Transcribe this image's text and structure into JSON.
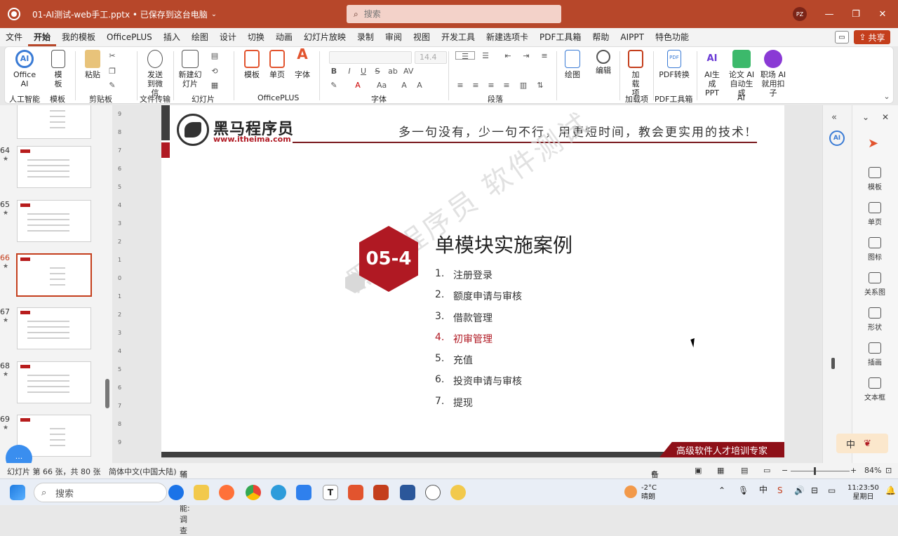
{
  "titlebar": {
    "doc_title": "01-AI测试-web手工.pptx • 已保存到这台电脑",
    "search_placeholder": "搜索",
    "avatar": "PZ",
    "minimize": "—",
    "restore": "❐",
    "close": "✕"
  },
  "menu": {
    "items": [
      "文件",
      "开始",
      "我的模板",
      "OfficePLUS",
      "插入",
      "绘图",
      "设计",
      "切换",
      "动画",
      "幻灯片放映",
      "录制",
      "审阅",
      "视图",
      "开发工具",
      "新建选项卡",
      "PDF工具箱",
      "帮助",
      "AIPPT",
      "特色功能"
    ],
    "active": "开始",
    "share": "共享"
  },
  "ribbon": {
    "buttons": {
      "office_ai": "Office AI",
      "template": "模板",
      "paste": "粘贴",
      "send_wechat": "发送到微信",
      "new_slide": "新建幻灯片",
      "opl_template": "模板",
      "opl_single": "单页",
      "opl_font": "字体",
      "draw": "绘图",
      "edit": "编辑",
      "addin": "加载项",
      "pdf_convert": "PDF转换",
      "ai_ppt": "AI生成PPT",
      "paper_ai": "论文 AI 自动生成",
      "job_ai": "职场 AI 就用扣子"
    },
    "groups": {
      "ai_assist": "人工智能",
      "template": "模板",
      "clipboard": "剪贴板",
      "file_transfer": "文件传输",
      "slides": "幻灯片",
      "officeplus": "OfficePLUS",
      "font": "字体",
      "paragraph": "段落",
      "addins": "加载项",
      "pdf": "PDF工具箱",
      "ai": "AI"
    },
    "font_size": "14.4"
  },
  "thumbnails": [
    {
      "num": "",
      "top": 0
    },
    {
      "num": "64",
      "star": "★"
    },
    {
      "num": "65",
      "star": "★"
    },
    {
      "num": "66",
      "star": "★",
      "selected": true
    },
    {
      "num": "67",
      "star": "★"
    },
    {
      "num": "68",
      "star": "★"
    },
    {
      "num": "69",
      "star": "★"
    }
  ],
  "slide": {
    "brand": "黑马程序员",
    "url": "www.itheima.com",
    "slogan": "多一句没有，少一句不行，用更短时间，教会更实用的技术!",
    "section_number": "05-4",
    "title": "单模块实施案例",
    "items": [
      {
        "num": "1.",
        "text": "注册登录"
      },
      {
        "num": "2.",
        "text": "额度申请与审核"
      },
      {
        "num": "3.",
        "text": "借款管理"
      },
      {
        "num": "4.",
        "text": "初审管理",
        "highlight": true
      },
      {
        "num": "5.",
        "text": "充值"
      },
      {
        "num": "6.",
        "text": "投资申请与审核"
      },
      {
        "num": "7.",
        "text": "提现"
      }
    ],
    "watermark": "黑马程序员 软件测试",
    "footer": "高级软件人才培训专家"
  },
  "right_panel": {
    "items": [
      "模板",
      "单页",
      "图标",
      "关系图",
      "形状",
      "插画",
      "文本框"
    ],
    "ime": "中"
  },
  "statusbar": {
    "slide_info": "幻灯片 第 66 张，共 80 张",
    "language": "简体中文(中国大陆)",
    "accessibility": "辅助功能: 调查",
    "notes": "备注",
    "zoom": "84%"
  },
  "taskbar": {
    "search": "搜索",
    "weather_temp": "-2°C",
    "weather_desc": "晴朗",
    "ime_lang": "中",
    "time": "11:23:50",
    "day": "星期日"
  },
  "colors": {
    "accent": "#b7472a",
    "slide_red": "#b01923"
  }
}
